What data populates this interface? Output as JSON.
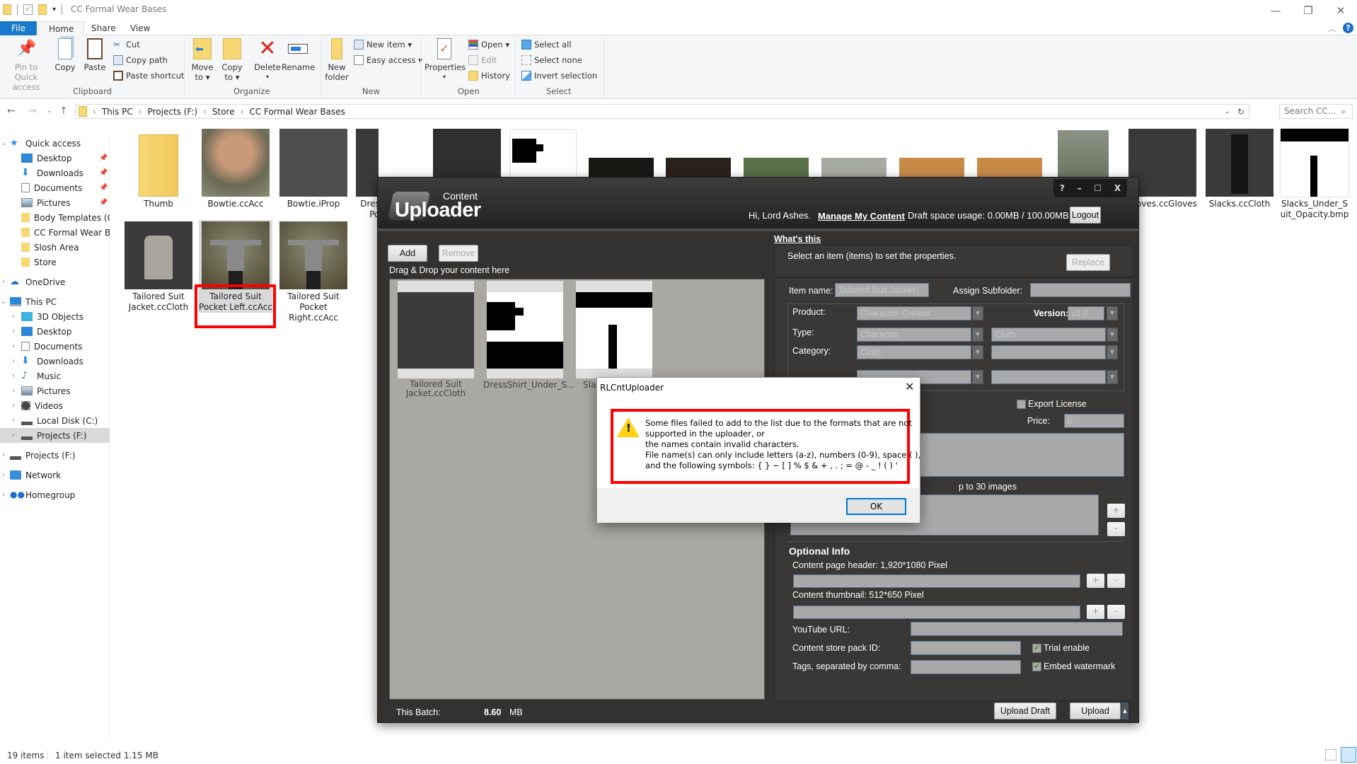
{
  "window": {
    "title": "CC Formal Wear Bases",
    "controls": {
      "minimize": "—",
      "restore": "❐",
      "close": "✕"
    }
  },
  "ribbon_tabs": [
    {
      "label": "File"
    },
    {
      "label": "Home"
    },
    {
      "label": "Share"
    },
    {
      "label": "View"
    }
  ],
  "ribbon": {
    "clipboard": {
      "pin": "Pin to Quick",
      "pin2": "access",
      "copy": "Copy",
      "paste": "Paste",
      "cut": "Cut",
      "copy_path": "Copy path",
      "paste_shortcut": "Paste shortcut",
      "group": "Clipboard"
    },
    "organize": {
      "move_to": "Move",
      "move_to2": "to ▾",
      "copy_to": "Copy",
      "copy_to2": "to ▾",
      "delete": "Delete",
      "rename": "Rename",
      "group": "Organize"
    },
    "new": {
      "new_folder": "New",
      "new_folder2": "folder",
      "new_item": "New item ▾",
      "easy_access": "Easy access ▾",
      "group": "New"
    },
    "open": {
      "properties": "Properties",
      "open": "Open ▾",
      "edit": "Edit",
      "history": "History",
      "group": "Open"
    },
    "select": {
      "select_all": "Select all",
      "select_none": "Select none",
      "invert": "Invert selection",
      "group": "Select"
    }
  },
  "address": {
    "breadcrumb": [
      "This PC",
      "Projects (F:)",
      "Store",
      "CC Formal Wear Bases"
    ],
    "search_placeholder": "Search CC..."
  },
  "sidebar": {
    "items": [
      {
        "label": "Quick access",
        "icon": "star-icon"
      },
      {
        "label": "Desktop",
        "icon": "desktop-icon",
        "pinned": true
      },
      {
        "label": "Downloads",
        "icon": "download-icon",
        "pinned": true
      },
      {
        "label": "Documents",
        "icon": "documents-icon",
        "pinned": true
      },
      {
        "label": "Pictures",
        "icon": "pictures-icon",
        "pinned": true
      },
      {
        "label": "Body Templates (Ge",
        "icon": "folder-icon"
      },
      {
        "label": "CC Formal Wear Ba",
        "icon": "folder-icon"
      },
      {
        "label": "Slosh Area",
        "icon": "folder-icon"
      },
      {
        "label": "Store",
        "icon": "folder-icon"
      },
      {
        "label": "OneDrive",
        "icon": "cloud-icon"
      },
      {
        "label": "This PC",
        "icon": "computer-icon"
      },
      {
        "label": "3D Objects",
        "icon": "cube-icon"
      },
      {
        "label": "Desktop",
        "icon": "desktop-icon"
      },
      {
        "label": "Documents",
        "icon": "documents-icon"
      },
      {
        "label": "Downloads",
        "icon": "download-icon"
      },
      {
        "label": "Music",
        "icon": "music-icon"
      },
      {
        "label": "Pictures",
        "icon": "pictures-icon"
      },
      {
        "label": "Videos",
        "icon": "video-icon"
      },
      {
        "label": "Local Disk (C:)",
        "icon": "disk-icon"
      },
      {
        "label": "Projects (F:)",
        "icon": "drive-icon",
        "selected": true
      },
      {
        "label": "Projects (F:)",
        "icon": "drive-icon"
      },
      {
        "label": "Network",
        "icon": "network-icon"
      },
      {
        "label": "Homegroup",
        "icon": "homegroup-icon"
      }
    ]
  },
  "files": [
    {
      "name": "Thumb"
    },
    {
      "name": "Bowtie.ccAcc"
    },
    {
      "name": "Bowtie.iProp"
    },
    {
      "name": "Dress Poc"
    },
    {
      "name": ""
    },
    {
      "name": ""
    },
    {
      "name": "oves.ccGloves"
    },
    {
      "name": "Slacks.ccCloth"
    },
    {
      "name": "Slacks_Under_Suit_Opacity.bmp"
    },
    {
      "name": "Tailored Suit Jacket.ccCloth"
    },
    {
      "name": "Tailored Suit Pocket Left.ccAcc",
      "selected": true
    },
    {
      "name": "Tailored Suit Pocket Right.ccAcc"
    }
  ],
  "status": {
    "count": "19 items",
    "selection": "1 item selected  1.15 MB"
  },
  "uploader": {
    "logo_small": "Content",
    "logo_big": "Uploader",
    "controls": [
      "?",
      "–",
      "☐",
      "X"
    ],
    "greeting": "Hi, Lord Ashes.",
    "manage_link": "Manage My Content",
    "draft_usage": "Draft space usage: 0.00MB / 100.00MB",
    "logout": "Logout",
    "add": "Add",
    "remove": "Remove",
    "drop_hint": "Drag & Drop your content here",
    "items": [
      {
        "label": "Tailored Suit Jacket.ccCloth"
      },
      {
        "label": "DressShirt_Under_S..."
      },
      {
        "label": "Sla"
      }
    ],
    "whats_this": "What's this",
    "select_hint": "Select an item (items) to set the properties.",
    "replace": "Replace",
    "item_name_label": "Item name:",
    "item_name_value": "Tailored Suit Jacket",
    "subfolder_label": "Assign Subfolder:",
    "product_label": "Product:",
    "product_value": "Character Creator",
    "version_label": "Version:",
    "version_value": "v2.0",
    "type_label": "Type:",
    "type_value": "Character",
    "type_value2": "Cloth",
    "category_label": "Category:",
    "category_value": "Cloth",
    "export_license": "Export License",
    "price_label": "Price:",
    "price_value": "0",
    "images_hint": "p to 30 images",
    "optional_title": "Optional Info",
    "header_label": "Content page header: 1,920*1080 Pixel",
    "thumb_label": "Content thumbnail: 512*650 Pixel",
    "youtube_label": "YouTube URL:",
    "packid_label": "Content store pack ID:",
    "tags_label": "Tags, separated by comma:",
    "trial_enable": "Trial enable",
    "trial_checked": true,
    "embed_watermark": "Embed watermark",
    "embed_checked": true,
    "batch_label": "This Batch:",
    "batch_value": "8.60",
    "batch_unit": "MB",
    "upload_draft": "Upload Draft",
    "upload": "Upload"
  },
  "dialog": {
    "title": "RLCntUploader",
    "lines": [
      "Some files failed to add to the list due to the formats that are not",
      "supported in the uploader, or",
      "the names contain invalid characters.",
      "File name(s) can only include letters (a-z), numbers (0-9), space ( ),",
      "and the following symbols: { } ~ [ ] % $ & + , . ; = @ - _ ! ( ) '"
    ],
    "ok": "OK"
  }
}
